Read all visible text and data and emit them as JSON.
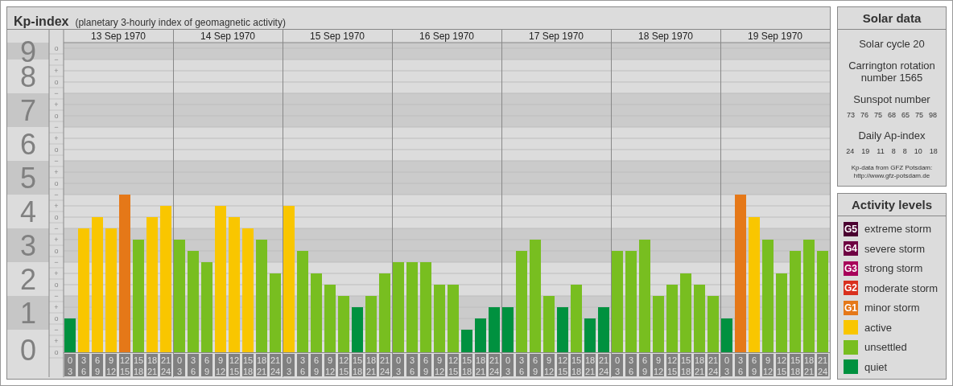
{
  "header": {
    "title": "Kp-index",
    "subtitle": "(planetary 3-hourly index of geomagnetic activity)"
  },
  "sublevel_marks": [
    "o",
    "−",
    "+",
    "o",
    "−",
    "+",
    "o",
    "−",
    "+",
    "o",
    "−",
    "+",
    "o",
    "−",
    "+",
    "o",
    "−",
    "+",
    "o",
    "−",
    "+",
    "o",
    "−",
    "+",
    "o",
    "−",
    "+",
    "o"
  ],
  "days": [
    {
      "date": "13 Sep 1970",
      "slots": [
        {
          "from": "0",
          "to": "3"
        },
        {
          "from": "3",
          "to": "6"
        },
        {
          "from": "6",
          "to": "9"
        },
        {
          "from": "9",
          "to": "12"
        },
        {
          "from": "12",
          "to": "15"
        },
        {
          "from": "15",
          "to": "18"
        },
        {
          "from": "18",
          "to": "21"
        },
        {
          "from": "21",
          "to": "24"
        }
      ]
    },
    {
      "date": "14 Sep 1970",
      "slots": [
        {
          "from": "0",
          "to": "3"
        },
        {
          "from": "3",
          "to": "6"
        },
        {
          "from": "6",
          "to": "9"
        },
        {
          "from": "9",
          "to": "12"
        },
        {
          "from": "12",
          "to": "15"
        },
        {
          "from": "15",
          "to": "18"
        },
        {
          "from": "18",
          "to": "21"
        },
        {
          "from": "21",
          "to": "24"
        }
      ]
    },
    {
      "date": "15 Sep 1970",
      "slots": [
        {
          "from": "0",
          "to": "3"
        },
        {
          "from": "3",
          "to": "6"
        },
        {
          "from": "6",
          "to": "9"
        },
        {
          "from": "9",
          "to": "12"
        },
        {
          "from": "12",
          "to": "15"
        },
        {
          "from": "15",
          "to": "18"
        },
        {
          "from": "18",
          "to": "21"
        },
        {
          "from": "21",
          "to": "24"
        }
      ]
    },
    {
      "date": "16 Sep 1970",
      "slots": [
        {
          "from": "0",
          "to": "3"
        },
        {
          "from": "3",
          "to": "6"
        },
        {
          "from": "6",
          "to": "9"
        },
        {
          "from": "9",
          "to": "12"
        },
        {
          "from": "12",
          "to": "15"
        },
        {
          "from": "15",
          "to": "18"
        },
        {
          "from": "18",
          "to": "21"
        },
        {
          "from": "21",
          "to": "24"
        }
      ]
    },
    {
      "date": "17 Sep 1970",
      "slots": [
        {
          "from": "0",
          "to": "3"
        },
        {
          "from": "3",
          "to": "6"
        },
        {
          "from": "6",
          "to": "9"
        },
        {
          "from": "9",
          "to": "12"
        },
        {
          "from": "12",
          "to": "15"
        },
        {
          "from": "15",
          "to": "18"
        },
        {
          "from": "18",
          "to": "21"
        },
        {
          "from": "21",
          "to": "24"
        }
      ]
    },
    {
      "date": "18 Sep 1970",
      "slots": [
        {
          "from": "0",
          "to": "3"
        },
        {
          "from": "3",
          "to": "6"
        },
        {
          "from": "6",
          "to": "9"
        },
        {
          "from": "9",
          "to": "12"
        },
        {
          "from": "12",
          "to": "15"
        },
        {
          "from": "15",
          "to": "18"
        },
        {
          "from": "18",
          "to": "21"
        },
        {
          "from": "21",
          "to": "24"
        }
      ]
    },
    {
      "date": "19 Sep 1970",
      "slots": [
        {
          "from": "0",
          "to": "3"
        },
        {
          "from": "3",
          "to": "6"
        },
        {
          "from": "6",
          "to": "9"
        },
        {
          "from": "9",
          "to": "12"
        },
        {
          "from": "12",
          "to": "15"
        },
        {
          "from": "15",
          "to": "18"
        },
        {
          "from": "18",
          "to": "21"
        },
        {
          "from": "21",
          "to": "24"
        }
      ]
    }
  ],
  "chart_data": {
    "type": "bar",
    "stacked": true,
    "grid": true,
    "ylim": [
      0,
      9.17
    ],
    "yticks": [
      9,
      8,
      7,
      6,
      5,
      4,
      3,
      2,
      1,
      0
    ],
    "series": [
      {
        "color": "#00913f",
        "values": [
          1,
          null,
          null,
          null,
          null,
          null,
          null,
          null,
          null,
          null,
          null,
          null,
          null,
          null,
          null,
          null,
          null,
          null,
          null,
          null,
          null,
          1.33,
          null,
          null,
          null,
          null,
          null,
          null,
          null,
          0.67,
          1,
          1.33,
          1.33,
          null,
          null,
          null,
          1.33,
          null,
          1,
          1.33,
          null,
          null,
          null,
          null,
          null,
          null,
          null,
          null,
          1,
          null,
          null,
          null,
          null,
          null,
          null,
          null
        ]
      },
      {
        "color": "#78be20",
        "values": [
          null,
          null,
          null,
          null,
          null,
          3.33,
          null,
          null,
          3.33,
          3,
          2.67,
          null,
          null,
          null,
          3.33,
          2.33,
          null,
          3,
          2.33,
          2,
          1.67,
          null,
          1.67,
          2.33,
          2.67,
          2.67,
          2.67,
          2,
          2,
          null,
          null,
          null,
          null,
          3,
          3.33,
          1.67,
          null,
          2,
          null,
          null,
          3,
          3,
          3.33,
          1.67,
          2,
          2.33,
          2,
          1.67,
          null,
          null,
          null,
          3.33,
          2.33,
          3,
          3.33,
          3
        ]
      },
      {
        "color": "#f9c600",
        "values": [
          null,
          3.67,
          4,
          3.67,
          null,
          null,
          4,
          4.33,
          null,
          null,
          null,
          4.33,
          4,
          3.67,
          null,
          null,
          4.33,
          null,
          null,
          null,
          null,
          null,
          null,
          null,
          null,
          null,
          null,
          null,
          null,
          null,
          null,
          null,
          null,
          null,
          null,
          null,
          null,
          null,
          null,
          null,
          null,
          null,
          null,
          null,
          null,
          null,
          null,
          null,
          null,
          null,
          4,
          null,
          null,
          null,
          null,
          null
        ]
      },
      {
        "color": "#e57818",
        "values": [
          null,
          null,
          null,
          null,
          4.67,
          null,
          null,
          null,
          null,
          null,
          null,
          null,
          null,
          null,
          null,
          null,
          null,
          null,
          null,
          null,
          null,
          null,
          null,
          null,
          null,
          null,
          null,
          null,
          null,
          null,
          null,
          null,
          null,
          null,
          null,
          null,
          null,
          null,
          null,
          null,
          null,
          null,
          null,
          null,
          null,
          null,
          null,
          null,
          null,
          4.67,
          null,
          null,
          null,
          null,
          null,
          null
        ]
      }
    ]
  },
  "solar_data": {
    "title": "Solar data",
    "cycle": "Solar cycle 20",
    "carrington": "Carrington rotation number 1565",
    "sunspot_title": "Sunspot number",
    "sunspot_numbers": [
      "73",
      "76",
      "75",
      "68",
      "65",
      "75",
      "98"
    ],
    "ap_title": "Daily Ap-index",
    "ap_numbers": [
      "24",
      "19",
      "11",
      "8",
      "8",
      "10",
      "18"
    ],
    "source_lines": [
      "Kp-data from GFZ Potsdam:",
      "http://www.gfz-potsdam.de"
    ]
  },
  "activity_levels": {
    "title": "Activity levels",
    "items": [
      {
        "badge": "G5",
        "label": "extreme storm",
        "color": "#4a0030"
      },
      {
        "badge": "G4",
        "label": "severe storm",
        "color": "#6e0042"
      },
      {
        "badge": "G3",
        "label": "strong storm",
        "color": "#a8005a"
      },
      {
        "badge": "G2",
        "label": "moderate storm",
        "color": "#d9301e"
      },
      {
        "badge": "G1",
        "label": "minor storm",
        "color": "#e57818"
      },
      {
        "label": "active",
        "color": "#f9c600"
      },
      {
        "label": "unsettled",
        "color": "#78be20"
      },
      {
        "label": "quiet",
        "color": "#00913f"
      }
    ]
  }
}
